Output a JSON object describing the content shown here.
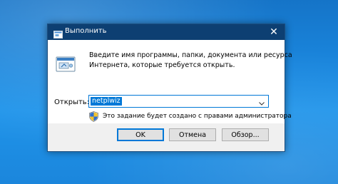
{
  "window": {
    "title": "Выполнить",
    "icon": "run-app-icon",
    "close_glyph": "✕"
  },
  "prompt": {
    "line1": "Введите имя программы, папки, документа или ресурса",
    "line2": "Интернета, которые требуется открыть."
  },
  "open": {
    "label": "Открыть:",
    "value": "netplwiz",
    "dropdown_icon": "chevron-down-icon"
  },
  "admin_note": {
    "icon": "uac-shield-icon",
    "text": "Это задание будет создано с правами администратора"
  },
  "buttons": {
    "ok": "OK",
    "cancel": "Отмена",
    "browse": "Обзор..."
  },
  "colors": {
    "titlebar": "#0d3f72",
    "accent": "#0078d7",
    "dialog_bg": "#f0f0f0",
    "desktop": "#1a86dd"
  }
}
